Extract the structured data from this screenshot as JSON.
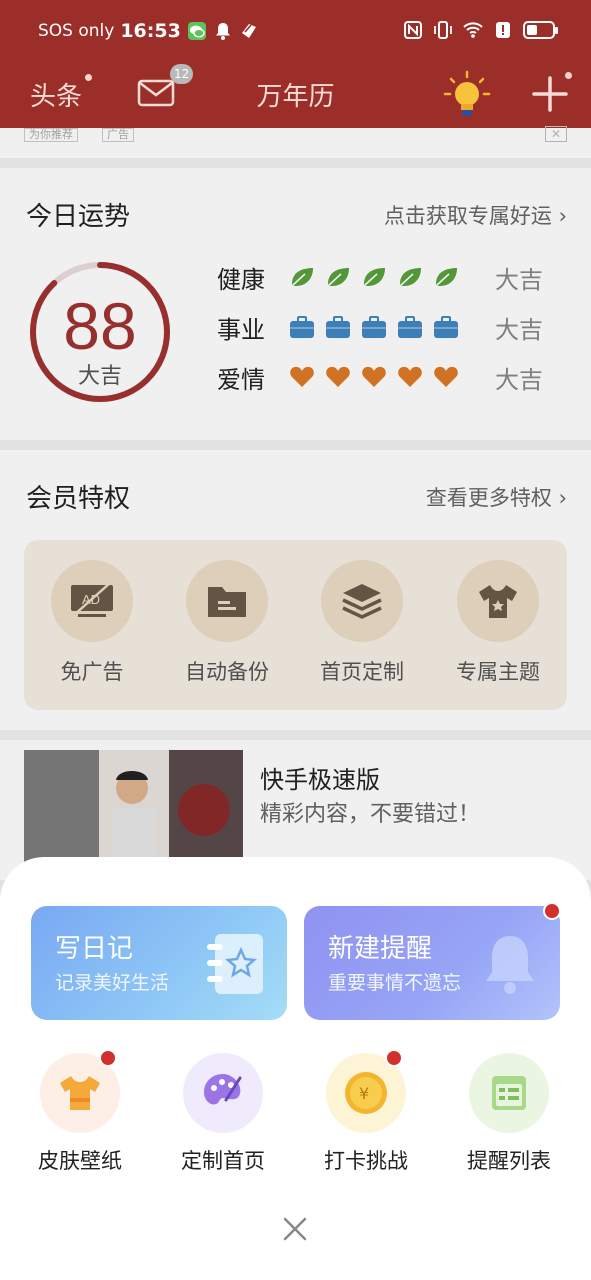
{
  "status_bar": {
    "left_text": "SOS only",
    "time": "16:53",
    "battery_percent": 40
  },
  "header": {
    "toutiao": "头条",
    "mail_badge": "12",
    "title": "万年历"
  },
  "ad_strip": {
    "tag1": "为你推荐",
    "tag2": "广告",
    "close": "✕"
  },
  "fortune": {
    "title": "今日运势",
    "link": "点击获取专属好运",
    "score": "88",
    "score_value": 88,
    "score_word": "大吉",
    "rows": [
      {
        "label": "健康",
        "icon": "leaf-icon",
        "count": 5,
        "result": "大吉",
        "color": "#5aa13c"
      },
      {
        "label": "事业",
        "icon": "briefcase-icon",
        "count": 5,
        "result": "大吉",
        "color": "#3f86c4"
      },
      {
        "label": "爱情",
        "icon": "heart-icon",
        "count": 5,
        "result": "大吉",
        "color": "#de7a24"
      }
    ]
  },
  "member": {
    "title": "会员特权",
    "link": "查看更多特权",
    "items": [
      {
        "label": "免广告",
        "icon": "no-ad-icon"
      },
      {
        "label": "自动备份",
        "icon": "folder-icon"
      },
      {
        "label": "首页定制",
        "icon": "layers-icon"
      },
      {
        "label": "专属主题",
        "icon": "tshirt-icon"
      }
    ]
  },
  "news": {
    "title": "快手极速版",
    "subtitle": "精彩内容，不要错过！"
  },
  "sheet": {
    "diary": {
      "title": "写日记",
      "subtitle": "记录美好生活"
    },
    "remind": {
      "title": "新建提醒",
      "subtitle": "重要事情不遗忘"
    },
    "items": [
      {
        "label": "皮肤壁纸",
        "icon": "tshirt-icon",
        "has_dot": true
      },
      {
        "label": "定制首页",
        "icon": "palette-icon",
        "has_dot": false
      },
      {
        "label": "打卡挑战",
        "icon": "coin-icon",
        "has_dot": true
      },
      {
        "label": "提醒列表",
        "icon": "calendar-list-icon",
        "has_dot": false
      }
    ]
  },
  "colors": {
    "brand": "#9c2e2a",
    "score_ring": "#a03230",
    "notification_dot": "#d2302c"
  }
}
